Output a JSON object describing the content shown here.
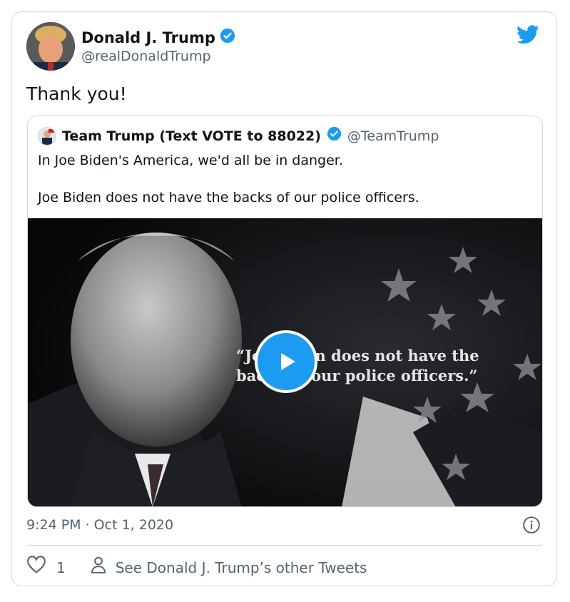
{
  "tweet": {
    "author_name": "Donald J. Trump",
    "author_handle": "@realDonaldTrump",
    "text": "Thank you!",
    "timestamp": "9:24 PM · Oct 1, 2020",
    "likes": "1",
    "other_tweets_label": "See Donald J. Trump’s other Tweets"
  },
  "quoted": {
    "author_name": "Team Trump (Text VOTE to 88022)",
    "author_handle": "@TeamTrump",
    "line1": "In Joe Biden's America, we'd all be in danger.",
    "line2": "Joe Biden does not have the backs of our police officers.",
    "video_caption_line1": "“Joe Biden does not have the",
    "video_caption_line2": "backs of our police officers.”"
  },
  "colors": {
    "accent": "#1d9bf0",
    "text_secondary": "#536471",
    "border": "#cfd9de"
  },
  "icons": [
    "twitter-bird-icon",
    "verified-badge-icon",
    "play-icon",
    "info-icon",
    "heart-icon",
    "person-icon"
  ]
}
